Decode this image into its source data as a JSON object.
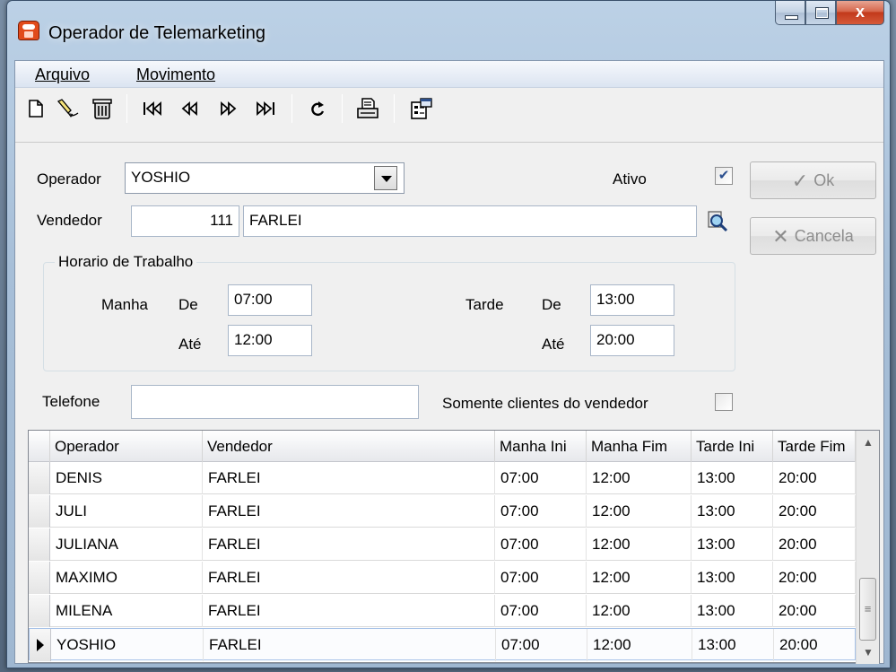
{
  "window": {
    "title": "Operador de Telemarketing"
  },
  "menu": [
    {
      "label": "Arquivo"
    },
    {
      "label": "Movimento"
    }
  ],
  "toolbar": {
    "icons": [
      "new-document-icon",
      "edit-icon",
      "delete-icon",
      "first-record-icon",
      "prev-record-icon",
      "next-record-icon",
      "last-record-icon",
      "refresh-icon",
      "print-icon",
      "properties-icon"
    ]
  },
  "form": {
    "operador_label": "Operador",
    "operador_value": "YOSHIO",
    "ativo_label": "Ativo",
    "ativo_checked": true,
    "vendedor_label": "Vendedor",
    "vendedor_code": "111",
    "vendedor_name": "FARLEI",
    "horario_title": "Horario de Trabalho",
    "manha_label": "Manha",
    "tarde_label": "Tarde",
    "de_label": "De",
    "ate_label": "Até",
    "manha_de": "07:00",
    "manha_ate": "12:00",
    "tarde_de": "13:00",
    "tarde_ate": "20:00",
    "telefone_label": "Telefone",
    "telefone_value": "",
    "somente_label": "Somente clientes do vendedor",
    "somente_checked": false
  },
  "buttons": {
    "ok_label": "Ok",
    "cancela_label": "Cancela"
  },
  "grid": {
    "columns": [
      "Operador",
      "Vendedor",
      "Manha Ini",
      "Manha Fim",
      "Tarde Ini",
      "Tarde Fim"
    ],
    "rows": [
      [
        "DENIS",
        "FARLEI",
        "07:00",
        "12:00",
        "13:00",
        "20:00"
      ],
      [
        "JULI",
        "FARLEI",
        "07:00",
        "12:00",
        "13:00",
        "20:00"
      ],
      [
        "JULIANA",
        "FARLEI",
        "07:00",
        "12:00",
        "13:00",
        "20:00"
      ],
      [
        "MAXIMO",
        "FARLEI",
        "07:00",
        "12:00",
        "13:00",
        "20:00"
      ],
      [
        "MILENA",
        "FARLEI",
        "07:00",
        "12:00",
        "13:00",
        "20:00"
      ],
      [
        "YOSHIO",
        "FARLEI",
        "07:00",
        "12:00",
        "13:00",
        "20:00"
      ]
    ],
    "current_row": 5
  }
}
